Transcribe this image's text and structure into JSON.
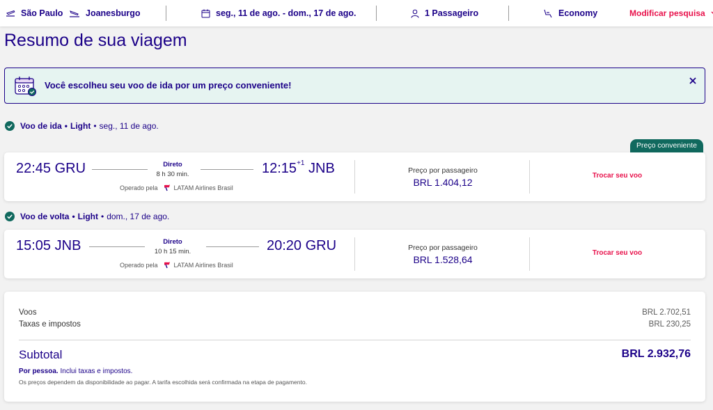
{
  "topbar": {
    "origin": "São Paulo",
    "destination": "Joanesburgo",
    "dates": "seg., 11 de ago. - dom., 17 de ago.",
    "passengers": "1 Passageiro",
    "cabin": "Economy",
    "modify_label": "Modificar pesquisa"
  },
  "page_title": "Resumo de sua viagem",
  "banner": {
    "text": "Você escolheu seu voo de ida por um preço conveniente!"
  },
  "badge": "Preço conveniente",
  "outbound": {
    "header_type": "Voo de ida",
    "header_fare": "Light",
    "header_date": "seg., 11 de ago.",
    "dep_time": "22:45",
    "dep_airport": "GRU",
    "stops": "Direto",
    "duration": "8 h 30 min.",
    "arr_time": "12:15",
    "arr_day_offset": "+1",
    "arr_airport": "JNB",
    "operated_by_label": "Operado pela",
    "airline": "LATAM Airlines Brasil",
    "price_label": "Preço por passageiro",
    "price": "BRL 1.404,12",
    "change_label": "Trocar seu voo"
  },
  "inbound": {
    "header_type": "Voo de volta",
    "header_fare": "Light",
    "header_date": "dom., 17 de ago.",
    "dep_time": "15:05",
    "dep_airport": "JNB",
    "stops": "Direto",
    "duration": "10 h 15 min.",
    "arr_time": "20:20",
    "arr_airport": "GRU",
    "operated_by_label": "Operado pela",
    "airline": "LATAM Airlines Brasil",
    "price_label": "Preço por passageiro",
    "price": "BRL 1.528,64",
    "change_label": "Trocar seu voo"
  },
  "summary": {
    "flights_label": "Voos",
    "flights_value": "BRL 2.702,51",
    "taxes_label": "Taxas e impostos",
    "taxes_value": "BRL 230,25",
    "subtotal_label": "Subtotal",
    "subtotal_value": "BRL 2.932,76",
    "per_person_bold": "Por pessoa.",
    "per_person_rest": "Inclui taxas e impostos.",
    "disclaimer": "Os preços dependem da disponibilidade ao pagar. A tarifa escolhida será confirmada na etapa de pagamento."
  },
  "colors": {
    "brand": "#1b0088",
    "accent": "#e8114b",
    "success": "#10695e",
    "banner_bg": "#e6f4f1"
  },
  "icons": {
    "origin": "takeoff-icon",
    "destination": "landing-icon",
    "dates": "calendar-icon",
    "passengers": "person-icon",
    "cabin": "seat-icon",
    "modify": "chevron-down-icon",
    "banner": "calendar-check-icon",
    "close": "close-icon",
    "segment": "check-circle-icon",
    "airline": "latam-logo-icon"
  }
}
